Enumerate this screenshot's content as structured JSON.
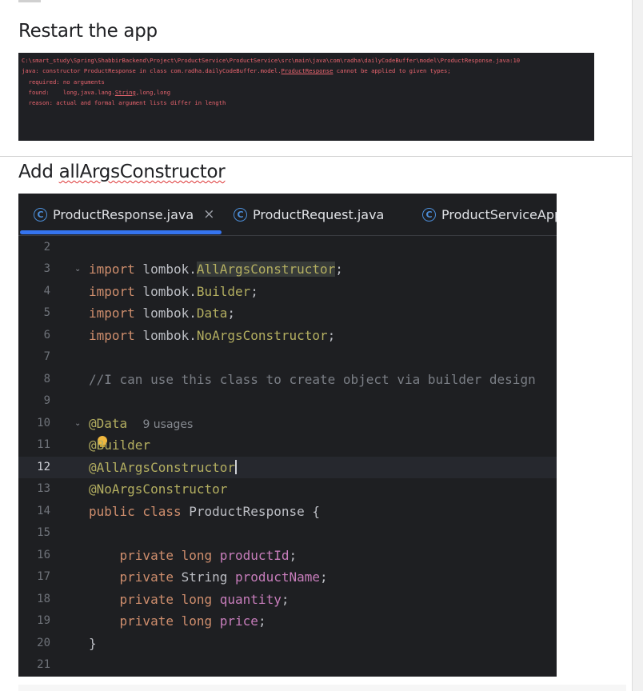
{
  "sections": {
    "restart_title": "Restart the app",
    "add_title_prefix": "Add ",
    "add_title_word": "allArgsConstructor"
  },
  "console": {
    "lines": [
      "C:\\smart_study\\Spring\\ShabbirBackend\\Project\\ProductService\\ProductService\\src\\main\\java\\com\\radha\\dailyCodeBuffer\\model\\ProductResponse.java:10",
      "java: constructor ProductResponse in class com.radha.dailyCodeBuffer.model.ProductResponse cannot be applied to given types;",
      "  required: no arguments",
      "  found:    long,java.lang.String,long,long",
      "  reason: actual and formal argument lists differ in length"
    ]
  },
  "editor": {
    "tabs": [
      {
        "label": "ProductResponse.java",
        "icon": "class-icon",
        "active": true,
        "closable": true
      },
      {
        "label": "ProductRequest.java",
        "icon": "class-icon",
        "active": false
      },
      {
        "label": "ProductServiceApp",
        "icon": "class-icon",
        "active": false
      }
    ],
    "close_glyph": "×",
    "class_glyph": "C",
    "current_line": "12",
    "usage_hint": "9 usages",
    "lines": [
      {
        "num": "2",
        "text": ""
      },
      {
        "num": "3",
        "text": "import lombok.AllArgsConstructor;"
      },
      {
        "num": "4",
        "text": "import lombok.Builder;"
      },
      {
        "num": "5",
        "text": "import lombok.Data;"
      },
      {
        "num": "6",
        "text": "import lombok.NoArgsConstructor;"
      },
      {
        "num": "7",
        "text": ""
      },
      {
        "num": "8",
        "text": "//I can use this class to create object via builder design"
      },
      {
        "num": "9",
        "text": ""
      },
      {
        "num": "10",
        "text": "@Data"
      },
      {
        "num": "11",
        "text": "@Builder"
      },
      {
        "num": "12",
        "text": "@AllArgsConstructor"
      },
      {
        "num": "13",
        "text": "@NoArgsConstructor"
      },
      {
        "num": "14",
        "text": "public class ProductResponse {"
      },
      {
        "num": "15",
        "text": ""
      },
      {
        "num": "16",
        "text": "    private long productId;"
      },
      {
        "num": "17",
        "text": "    private String productName;"
      },
      {
        "num": "18",
        "text": "    private long quantity;"
      },
      {
        "num": "19",
        "text": "    private long price;"
      },
      {
        "num": "20",
        "text": "}"
      },
      {
        "num": "21",
        "text": ""
      }
    ]
  },
  "colors": {
    "keyword": "#cf8e6d",
    "annotation": "#b3ae60",
    "field": "#c77dbb",
    "comment": "#7a7e85",
    "error_text": "#e8646e",
    "tab_accent": "#3574f0"
  }
}
